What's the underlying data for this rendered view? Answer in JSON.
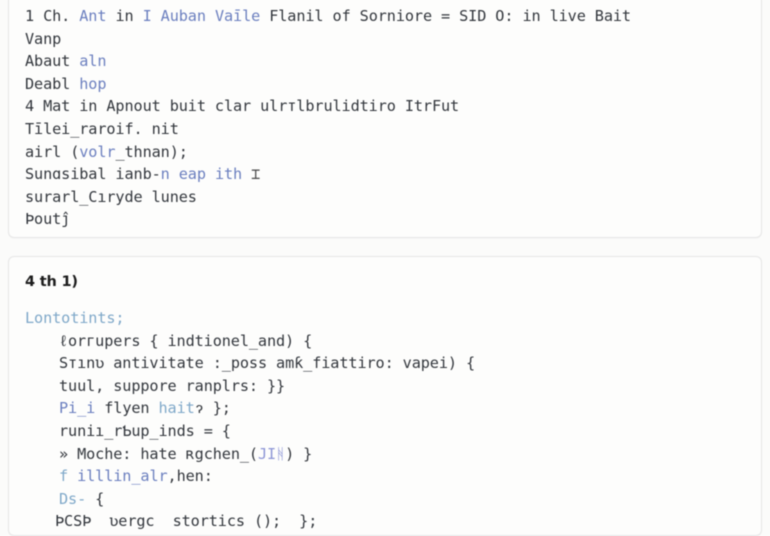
{
  "panels": [
    {
      "id": "top-code-panel",
      "lines": [
        {
          "segments": [
            {
              "text": "1 Ch. ",
              "color": "plain"
            },
            {
              "text": "Ant",
              "color": "blue"
            },
            {
              "text": " in ",
              "color": "plain"
            },
            {
              "text": "I Auban Vaīle",
              "color": "blue"
            },
            {
              "text": " Flanil of Sorniore = SID O: in live Bait",
              "color": "plain"
            }
          ]
        },
        {
          "segments": [
            {
              "text": "Vanp",
              "color": "plain"
            }
          ]
        },
        {
          "segments": [
            {
              "text": "Abaut ",
              "color": "plain"
            },
            {
              "text": "aln",
              "color": "blue"
            }
          ]
        },
        {
          "segments": [
            {
              "text": "Deabl ",
              "color": "plain"
            },
            {
              "text": "hop",
              "color": "blue"
            }
          ]
        },
        {
          "segments": [
            {
              "text": "4 Mat in Apnout buit clar ulrтlbrulidtiro ItrFut",
              "color": "plain"
            }
          ]
        },
        {
          "segments": [
            {
              "text": "Tīlei_raroif. nit",
              "color": "plain"
            }
          ]
        },
        {
          "segments": [
            {
              "text": "airl (",
              "color": "plain"
            },
            {
              "text": "volr",
              "color": "blue"
            },
            {
              "text": "_thnan);",
              "color": "plain"
            }
          ]
        },
        {
          "segments": [
            {
              "text": "Sunɑsibal ianb-",
              "color": "plain"
            },
            {
              "text": "n",
              "color": "blue"
            },
            {
              "text": " ",
              "color": "plain"
            },
            {
              "text": "eap",
              "color": "blue"
            },
            {
              "text": " ",
              "color": "plain"
            },
            {
              "text": "ith",
              "color": "blue"
            },
            {
              "text": " ⌶",
              "color": "caret"
            }
          ]
        },
        {
          "segments": [
            {
              "text": "surarl_Cıryde lunes",
              "color": "plain"
            }
          ]
        },
        {
          "segments": [
            {
              "text": "Þoutĵ",
              "color": "plain"
            }
          ]
        }
      ]
    },
    {
      "id": "bottom-code-panel",
      "heading": "4 th 1)",
      "lines": [
        {
          "indent": 0,
          "segments": [
            {
              "text": "Lontotints;",
              "color": "steel"
            }
          ]
        },
        {
          "indent": 1,
          "segments": [
            {
              "text": "ℓorгupers { indtionel_and) {",
              "color": "plain"
            }
          ]
        },
        {
          "indent": 1,
          "segments": [
            {
              "text": "Sтınʋ antivitate :_poss amƙ_fiattiro: vapei) {",
              "color": "plain"
            }
          ]
        },
        {
          "indent": 1,
          "segments": [
            {
              "text": "tuul, suppore ranplrs: }}",
              "color": "plain"
            }
          ]
        },
        {
          "indent": 1,
          "segments": [
            {
              "text": "Pi_i",
              "color": "blue"
            },
            {
              "text": " flyen ",
              "color": "plain"
            },
            {
              "text": "hait",
              "color": "steel"
            },
            {
              "text": "ɂ };",
              "color": "plain"
            }
          ]
        },
        {
          "indent": 1,
          "segments": [
            {
              "text": "runiı_rƄup_inds = {",
              "color": "plain"
            }
          ]
        },
        {
          "indent": 1,
          "segments": [
            {
              "text": "» Moche: hate ʀgchen_(",
              "color": "plain"
            },
            {
              "text": "JIᚻ",
              "color": "lav"
            },
            {
              "text": ") }",
              "color": "plain"
            }
          ]
        },
        {
          "indent": 1,
          "segments": [
            {
              "text": "f ",
              "color": "steel"
            },
            {
              "text": "illlin_alr",
              "color": "blue"
            },
            {
              "text": ",hen:",
              "color": "plain"
            }
          ]
        },
        {
          "indent": 1,
          "segments": [
            {
              "text": "Ds-",
              "color": "steel"
            },
            {
              "text": " {",
              "color": "plain"
            }
          ]
        },
        {
          "indent": 2,
          "segments": [
            {
              "text": "ÞCSÞ  ʋеrgс  stоrtiсs ();  };",
              "color": "plain"
            }
          ]
        }
      ]
    }
  ],
  "colors": {
    "page_background": "#fbfbfa",
    "card_background": "#fdfdfc",
    "card_border": "#e6e6e6",
    "text_default": "#33373d",
    "accent_blue": "#6b7fbf",
    "accent_steel": "#7fa8c9",
    "accent_lavender": "#8d96d6"
  }
}
